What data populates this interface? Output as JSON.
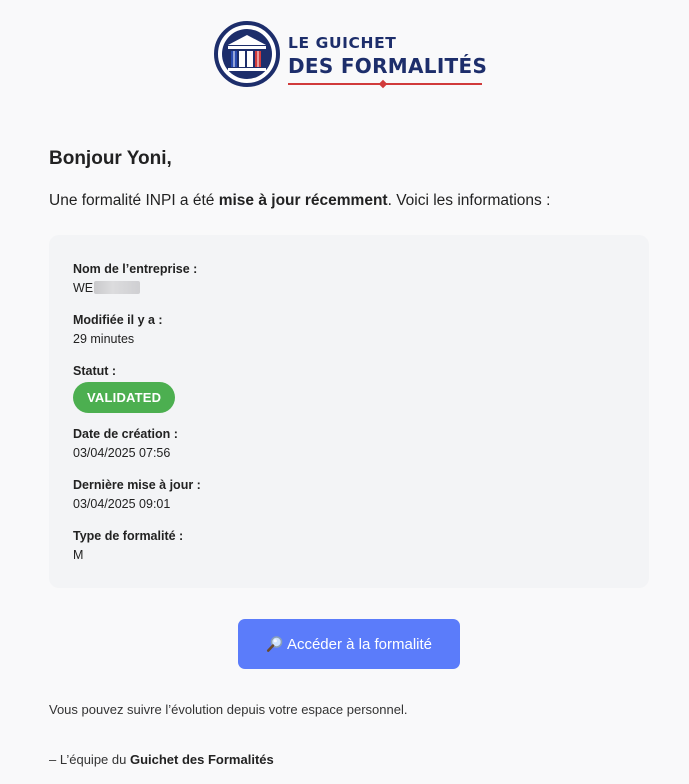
{
  "logo": {
    "line1": "LE GUICHET",
    "line2": "DES FORMALITÉS"
  },
  "greeting": "Bonjour Yoni,",
  "intro": {
    "before": "Une formalité INPI a été ",
    "bold": "mise à jour récemment",
    "after": ". Voici les informations :"
  },
  "details": {
    "company": {
      "label": "Nom de l’entreprise :",
      "value": "WE"
    },
    "modified": {
      "label": "Modifiée il y a :",
      "value": "29 minutes"
    },
    "status": {
      "label": "Statut :",
      "value": "VALIDATED"
    },
    "created": {
      "label": "Date de création :",
      "value": "03/04/2025 07:56"
    },
    "updated": {
      "label": "Dernière mise à jour :",
      "value": "03/04/2025 09:01"
    },
    "type": {
      "label": "Type de formalité :",
      "value": "M"
    }
  },
  "cta": {
    "label": "Accéder à la formalité",
    "icon": "magnifier-icon"
  },
  "footer_note": "Vous pouvez suivre l’évolution depuis votre espace personnel.",
  "signature": {
    "prefix": "– L’équipe du ",
    "bold": "Guichet des Formalités"
  },
  "colors": {
    "brand_navy": "#1d2e6b",
    "brand_red": "#d13b3b",
    "status_green": "#4caf50",
    "button_blue": "#5b7cfa",
    "card_bg": "#f3f4f6"
  }
}
